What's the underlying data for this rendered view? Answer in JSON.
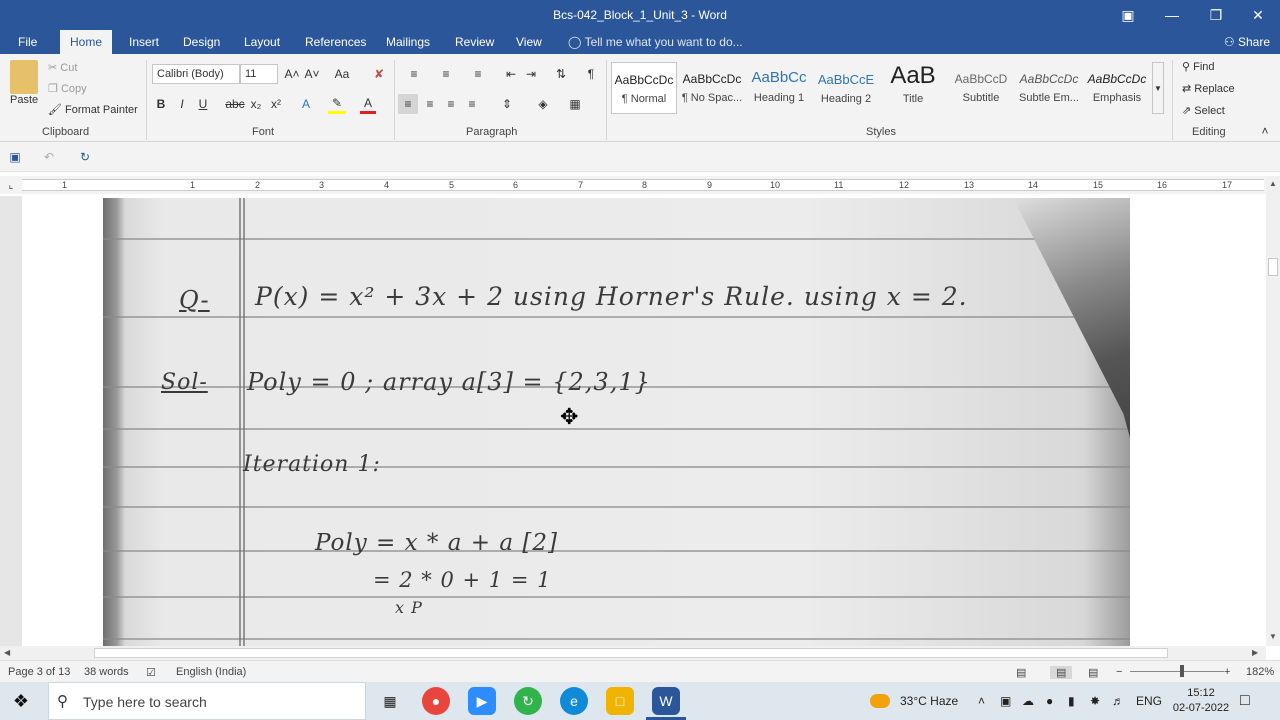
{
  "window": {
    "title": "Bcs-042_Block_1_Unit_3 - Word",
    "controls": [
      "restore",
      "minimize",
      "maximize",
      "close"
    ]
  },
  "tabs": [
    "File",
    "Home",
    "Insert",
    "Design",
    "Layout",
    "References",
    "Mailings",
    "Review",
    "View"
  ],
  "active_tab": "Home",
  "tell_me": "Tell me what you want to do...",
  "share": "Share",
  "ribbon": {
    "clipboard": {
      "paste": "Paste",
      "cut": "Cut",
      "copy": "Copy",
      "format_painter": "Format Painter",
      "label": "Clipboard"
    },
    "font": {
      "family": "Calibri (Body)",
      "size": "11",
      "label": "Font"
    },
    "paragraph": {
      "label": "Paragraph"
    },
    "styles": {
      "items": [
        {
          "sample": "AaBbCcDc",
          "name": "¶ Normal"
        },
        {
          "sample": "AaBbCcDc",
          "name": "¶ No Spac..."
        },
        {
          "sample": "AaBbCc",
          "name": "Heading 1"
        },
        {
          "sample": "AaBbCcE",
          "name": "Heading 2"
        },
        {
          "sample": "AaB",
          "name": "Title"
        },
        {
          "sample": "AaBbCcD",
          "name": "Subtitle"
        },
        {
          "sample": "AaBbCcDc",
          "name": "Subtle Em..."
        },
        {
          "sample": "AaBbCcDc",
          "name": "Emphasis"
        }
      ],
      "label": "Styles"
    },
    "editing": {
      "find": "Find",
      "replace": "Replace",
      "select": "Select",
      "label": "Editing"
    }
  },
  "ruler_numbers": [
    "1",
    "1",
    "2",
    "3",
    "4",
    "5",
    "6",
    "7",
    "8",
    "9",
    "10",
    "11",
    "12",
    "13",
    "14",
    "15",
    "16",
    "17"
  ],
  "handwriting": {
    "q_mark": "Q-",
    "question": "P(x) = x² + 3x + 2  using  Horner's Rule. using x = 2.",
    "sol_mark": "Sol-",
    "sol_line": "Poly = 0 ;   array a[3] = {2,3,1}",
    "iteration": "Iteration 1:",
    "poly_line1": "Poly = x * a + a [2]",
    "poly_line2": "= 2 * 0 + 1  = 1",
    "poly_line3": "x   P"
  },
  "status": {
    "page": "Page 3 of 13",
    "words": "38 words",
    "language": "English (India)",
    "zoom": "182%"
  },
  "taskbar": {
    "search_placeholder": "Type here to search",
    "weather": "33°C  Haze",
    "lang": "ENG",
    "time": "15:12",
    "date": "02-07-2022"
  }
}
